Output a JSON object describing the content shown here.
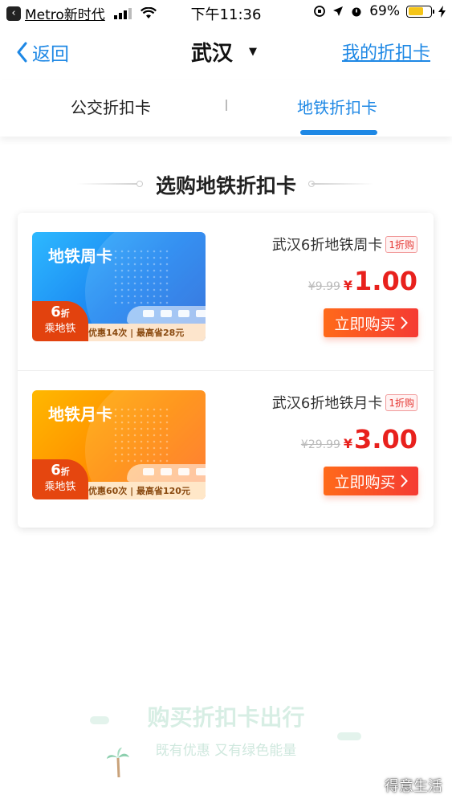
{
  "status_bar": {
    "app": "Metro新时代",
    "time": "下午11:36",
    "battery": "69%",
    "battery_level": 0.69
  },
  "nav": {
    "back_label": "返回",
    "city": "武汉",
    "city_caret": "▼",
    "my_card": "我的折扣卡"
  },
  "tabs": [
    {
      "label": "公交折扣卡",
      "active": false
    },
    {
      "label": "地铁折扣卡",
      "active": true
    }
  ],
  "section_title": "选购地铁折扣卡",
  "products": [
    {
      "card_title": "地铁周卡",
      "discount_num": "6",
      "discount_unit": "折",
      "discount_text": "乘地铁",
      "footer": "优惠14次 | 最高省28元",
      "name": "武汉6折地铁周卡",
      "badge": "1折购",
      "old_price": "¥9.99",
      "currency": "¥",
      "price": "1.00",
      "buy_label": "立即购买"
    },
    {
      "card_title": "地铁月卡",
      "discount_num": "6",
      "discount_unit": "折",
      "discount_text": "乘地铁",
      "footer": "优惠60次 | 最高省120元",
      "name": "武汉6折地铁月卡",
      "badge": "1折购",
      "old_price": "¥29.99",
      "currency": "¥",
      "price": "3.00",
      "buy_label": "立即购买"
    }
  ],
  "slogan": {
    "title": "购买折扣卡出行",
    "subtitle": "既有优惠 又有绿色能量"
  },
  "watermark": "得意生活",
  "colors": {
    "accent": "#1e88e5",
    "price_red": "#e8211d",
    "buy_gradient_start": "#ff6a1a",
    "buy_gradient_end": "#f53a33"
  }
}
